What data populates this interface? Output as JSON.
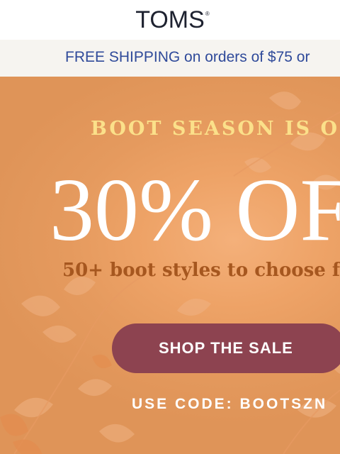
{
  "brand": {
    "logo_text": "TOMS",
    "trademark": "®"
  },
  "shipping_bar": {
    "text": "FREE SHIPPING on orders of $75 or"
  },
  "hero": {
    "eyebrow": "BOOT SEASON IS O",
    "headline": "30% OF",
    "subhead": "50+ boot styles to choose f",
    "cta_label": "SHOP THE SALE",
    "promo_code": "USE CODE: BOOTSZN"
  },
  "colors": {
    "logo": "#1e2230",
    "shipping_text": "#2f4a9a",
    "shipping_bg": "#f6f4f0",
    "hero_bg": "#eea367",
    "eyebrow": "#fbe08a",
    "subhead": "#a6571f",
    "cta_bg": "#8d4350"
  },
  "decorations": {
    "background_art": "autumn-leaves"
  }
}
